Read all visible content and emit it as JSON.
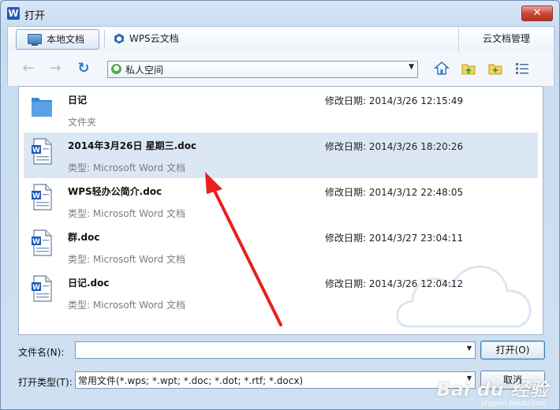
{
  "window": {
    "title": "打开",
    "app_icon_letter": "W",
    "close_glyph": "✕"
  },
  "tabs": {
    "local": "本地文档",
    "wps_cloud": "WPS云文档",
    "cloud_manage": "云文档管理"
  },
  "navbar": {
    "back_glyph": "←",
    "forward_glyph": "→",
    "refresh_glyph": "↻",
    "location": "私人空间",
    "icons": [
      "home-icon",
      "up-folder-icon",
      "new-folder-icon",
      "view-list-icon"
    ]
  },
  "files": [
    {
      "name": "日记",
      "type": "文件夹",
      "date": "修改日期: 2014/3/26 12:15:49",
      "kind": "folder",
      "selected": false
    },
    {
      "name": "2014年3月26日 星期三.doc",
      "type": "类型: Microsoft Word 文档",
      "date": "修改日期: 2014/3/26 18:20:26",
      "kind": "doc",
      "selected": true
    },
    {
      "name": "WPS轻办公简介.doc",
      "type": "类型: Microsoft Word 文档",
      "date": "修改日期: 2014/3/12 22:48:05",
      "kind": "doc",
      "selected": false
    },
    {
      "name": "群.doc",
      "type": "类型: Microsoft Word 文档",
      "date": "修改日期: 2014/3/27 23:04:11",
      "kind": "doc",
      "selected": false
    },
    {
      "name": "日记.doc",
      "type": "类型: Microsoft Word 文档",
      "date": "修改日期: 2014/3/26 12:04:12",
      "kind": "doc",
      "selected": false
    }
  ],
  "bottom": {
    "filename_label": "文件名(N):",
    "filename_value": "",
    "filetype_label": "打开类型(T):",
    "filetype_value": "常用文件(*.wps; *.wpt; *.doc; *.dot; *.rtf; *.docx)",
    "open_button": "打开(O)",
    "cancel_button": "取消"
  },
  "watermark": {
    "text": "Bai du 经验",
    "sub": "jingyan.baidu.com"
  },
  "colors": {
    "accent": "#2b78c9",
    "selected_row": "#dce7f5",
    "annotation_arrow": "#e8201e"
  }
}
